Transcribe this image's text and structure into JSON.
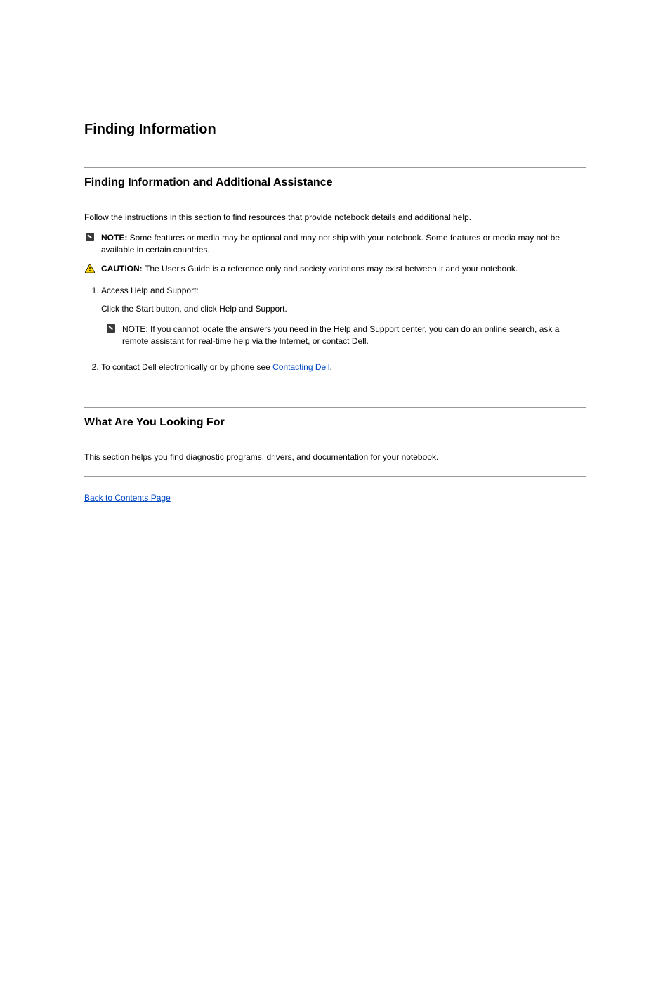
{
  "heading_main": "Finding Information",
  "section1": {
    "title": "Finding Information and Additional Assistance",
    "intro": "Follow the instructions in this section to find resources that provide notebook details and additional help.",
    "note": {
      "lead": "NOTE: ",
      "text": "Some features or media may be optional and may not ship with your notebook. Some features or media may not be available in certain countries."
    },
    "caution": {
      "lead": "CAUTION: ",
      "text": "The User's Guide is a reference only and society variations may exist between it and your notebook."
    },
    "steps": {
      "s1": "Access Help and Support:",
      "s1a": "Click the Start button, and click Help and Support.",
      "s1_note_lead": "NOTE: ",
      "s1_note_text": "If you cannot locate the answers you need in the Help and Support center, you can do an online search, ask a remote assistant for real-time help via the Internet, or contact Dell.",
      "s2_prefix": "To contact Dell electronically or by phone see ",
      "s2_link": "Contacting Dell",
      "s2_suffix": "."
    }
  },
  "section2": {
    "title": "What Are You Looking For",
    "intro": "This section helps you find diagnostic programs, drivers, and documentation for your notebook."
  },
  "back_link": "Back to Contents Page"
}
